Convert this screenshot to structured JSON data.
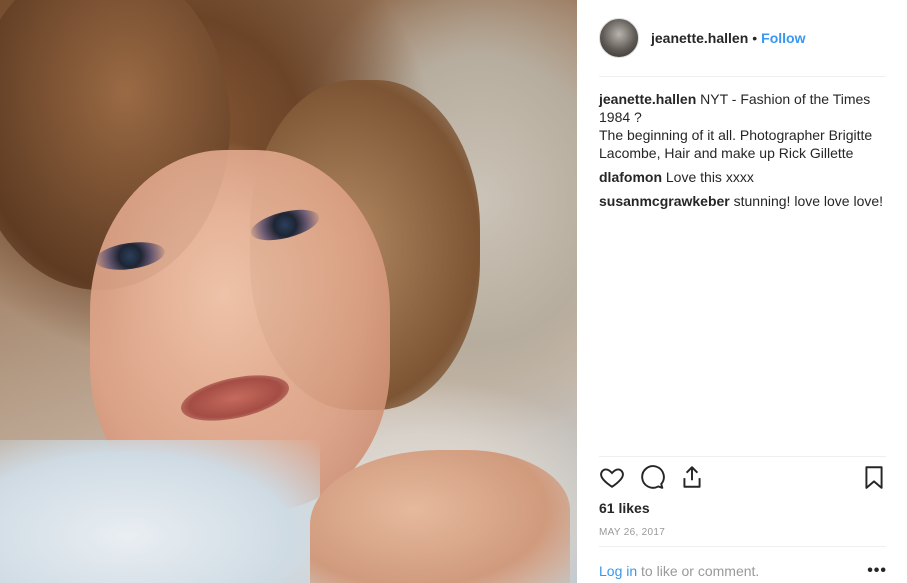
{
  "post": {
    "username": "jeanette.hallen",
    "separator": "•",
    "follow_label": "Follow",
    "likes": "61 likes",
    "date": "MAY 26, 2017"
  },
  "comments": [
    {
      "author": "jeanette.hallen",
      "text": "NYT - Fashion of the Times 1984 ?\nThe beginning of it all. Photographer Brigitte Lacombe, Hair and make up Rick Gillette"
    },
    {
      "author": "dlafomon",
      "text": "Love this xxxx"
    },
    {
      "author": "susanmcgrawkeber",
      "text": "stunning! love love love!"
    }
  ],
  "footer": {
    "login_link": "Log in",
    "login_text": " to like or comment.",
    "more_label": "•••"
  },
  "icons": {
    "like": "heart-icon",
    "comment": "comment-icon",
    "share": "share-icon",
    "save": "bookmark-icon",
    "more": "more-options-icon"
  },
  "colors": {
    "link": "#3897f0",
    "text": "#262626",
    "muted": "#999999"
  }
}
